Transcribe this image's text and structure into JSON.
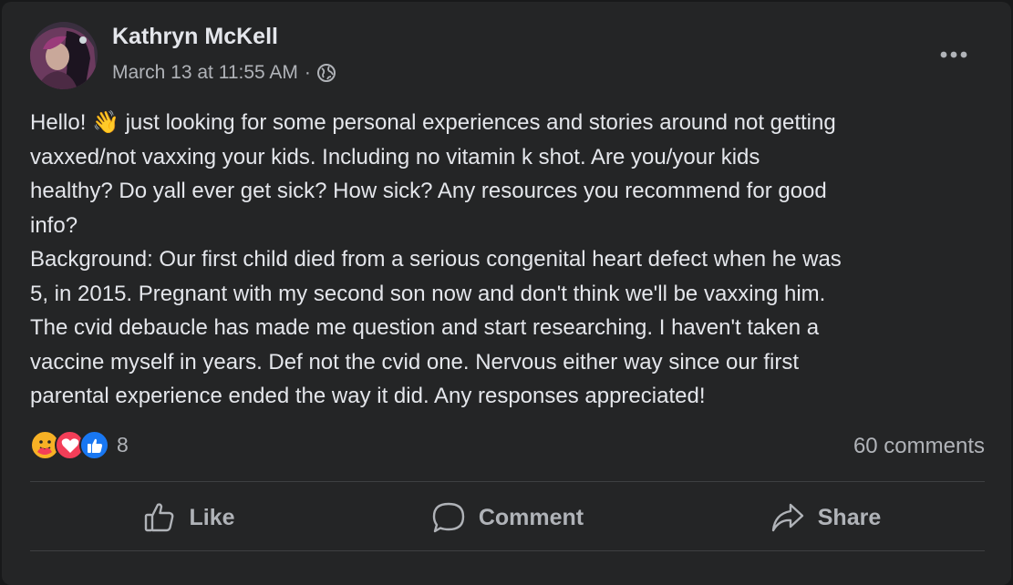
{
  "post": {
    "author": "Kathryn McKell",
    "timestamp": "March 13 at 11:55 AM",
    "separator": "·",
    "privacy_icon": "globe-icon",
    "more_icon": "more-options-icon",
    "body_lines": [
      "Hello! 👋 just looking for some personal experiences and stories around not getting",
      "vaxxed/not vaxxing your kids. Including no vitamin k shot.  Are you/your kids",
      "healthy? Do yall ever get sick? How sick? Any resources you recommend for good",
      "info?",
      "Background: Our first child died from a serious congenital heart defect when he was",
      "5, in 2015. Pregnant with my second son now and don't think we'll be vaxxing him.",
      "The cvid debaucle has made me question and start researching. I haven't taken a",
      "vaccine myself in years. Def not the cvid one. Nervous either way since our first",
      "parental experience ended the way it did. Any responses appreciated!"
    ]
  },
  "stats": {
    "reaction_icons": [
      "care-reaction-icon",
      "love-reaction-icon",
      "like-reaction-icon"
    ],
    "reaction_count": "8",
    "comments": "60 comments"
  },
  "actions": {
    "like": "Like",
    "comment": "Comment",
    "share": "Share"
  },
  "colors": {
    "background": "#242526",
    "text_primary": "#e4e6eb",
    "text_secondary": "#b0b3b8",
    "like_blue": "#1877f2",
    "love_red": "#f33e58",
    "care_yellow": "#f7b125"
  }
}
